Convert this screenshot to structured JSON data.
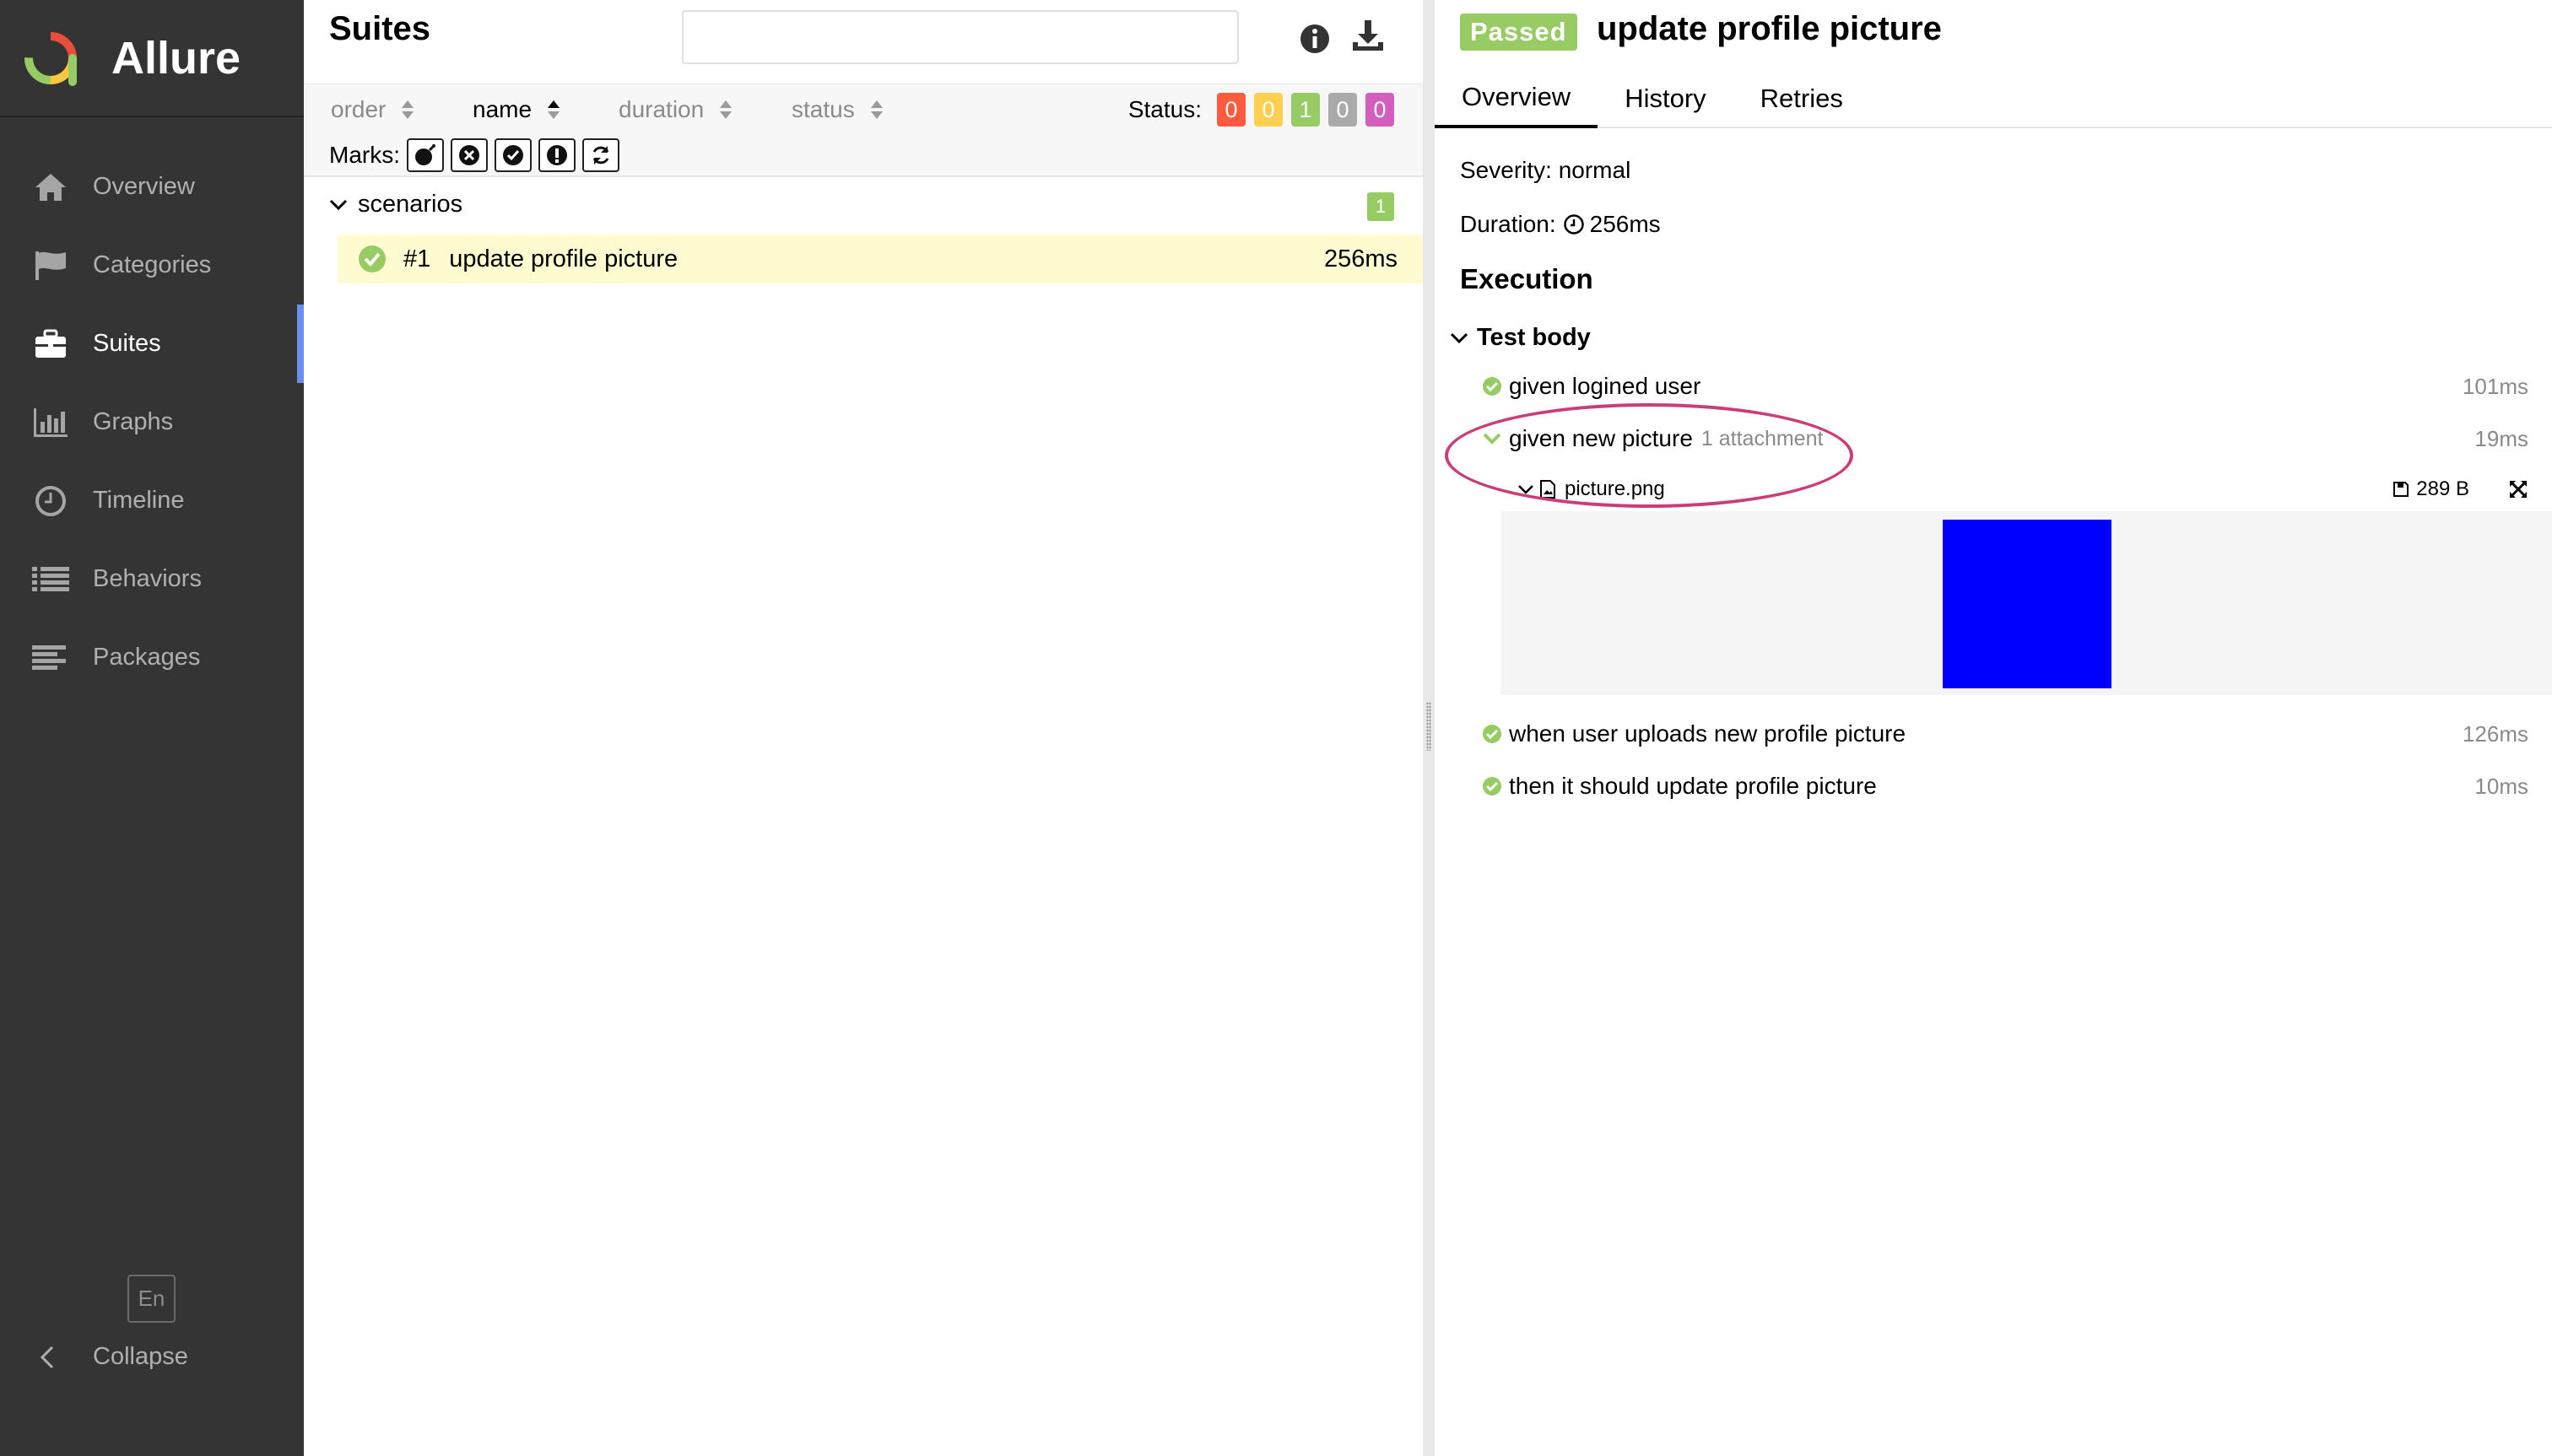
{
  "app": {
    "name": "Allure",
    "logo_colors": [
      "#e94e3d",
      "#fbc740",
      "#97cc64",
      "#3d8ee9"
    ]
  },
  "sidebar": {
    "items": [
      {
        "label": "Overview",
        "icon": "home-icon"
      },
      {
        "label": "Categories",
        "icon": "flag-icon"
      },
      {
        "label": "Suites",
        "icon": "briefcase-icon",
        "active": true
      },
      {
        "label": "Graphs",
        "icon": "bar-chart-icon"
      },
      {
        "label": "Timeline",
        "icon": "clock-icon"
      },
      {
        "label": "Behaviors",
        "icon": "list-icon"
      },
      {
        "label": "Packages",
        "icon": "align-left-icon"
      }
    ],
    "language": "En",
    "collapse_label": "Collapse"
  },
  "suites": {
    "title": "Suites",
    "search": {
      "value": "",
      "placeholder": ""
    },
    "sort": {
      "order": "order",
      "name": "name",
      "duration": "duration",
      "status": "status"
    },
    "status_label": "Status:",
    "status_counts": [
      {
        "value": "0",
        "color": "#fd5a3e"
      },
      {
        "value": "0",
        "color": "#ffd050"
      },
      {
        "value": "1",
        "color": "#97cc64"
      },
      {
        "value": "0",
        "color": "#aaaaaa"
      },
      {
        "value": "0",
        "color": "#d35ebe"
      }
    ],
    "marks_label": "Marks:",
    "group": {
      "name": "scenarios",
      "count": "1"
    },
    "test": {
      "number": "#1",
      "name": "update profile picture",
      "duration": "256ms"
    }
  },
  "detail": {
    "status": "Passed",
    "title": "update profile picture",
    "tabs": [
      "Overview",
      "History",
      "Retries"
    ],
    "severity": "Severity: normal",
    "duration_label": "Duration:",
    "duration": "256ms",
    "execution_title": "Execution",
    "test_body_label": "Test body",
    "steps": [
      {
        "name": "given logined user",
        "duration": "101ms"
      },
      {
        "name": "given new picture",
        "attachment_note": "1 attachment",
        "duration": "19ms"
      },
      {
        "name": "when user uploads new profile picture",
        "duration": "126ms"
      },
      {
        "name": "then it should update profile picture",
        "duration": "10ms"
      }
    ],
    "attachment": {
      "name": "picture.png",
      "size": "289 B",
      "preview_color": "#0000ff"
    }
  }
}
